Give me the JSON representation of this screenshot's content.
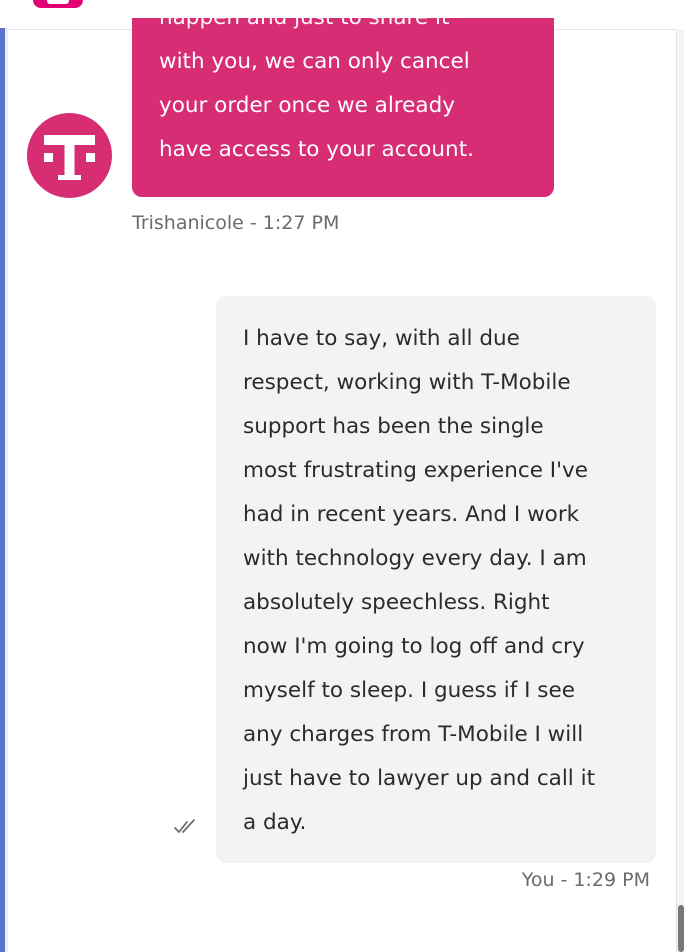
{
  "agent_message": {
    "avatar": "tmobile-logo-icon",
    "cut_line": "happen and just to share it",
    "lines": [
      "with you, we can only cancel",
      "your order once we already",
      "have access to your account."
    ],
    "meta": "Trishanicole - 1:27 PM"
  },
  "user_message": {
    "lines": [
      "I have to say, with all due",
      "respect, working with T-Mobile",
      "support has been the single",
      "most frustrating experience I've",
      "had in recent years. And I work",
      "with technology every day. I am",
      "absolutely speechless. Right",
      "now I'm going to log off and cry",
      "myself to sleep. I guess if I see",
      "any charges from T-Mobile I will",
      "just have to lawyer up and call it",
      "a day."
    ],
    "read_icon": "double-check-icon",
    "meta": "You - 1:29 PM"
  },
  "colors": {
    "brand_magenta": "#d62d74",
    "user_bubble": "#f3f3f3",
    "meta_text": "#6b6b6b"
  }
}
